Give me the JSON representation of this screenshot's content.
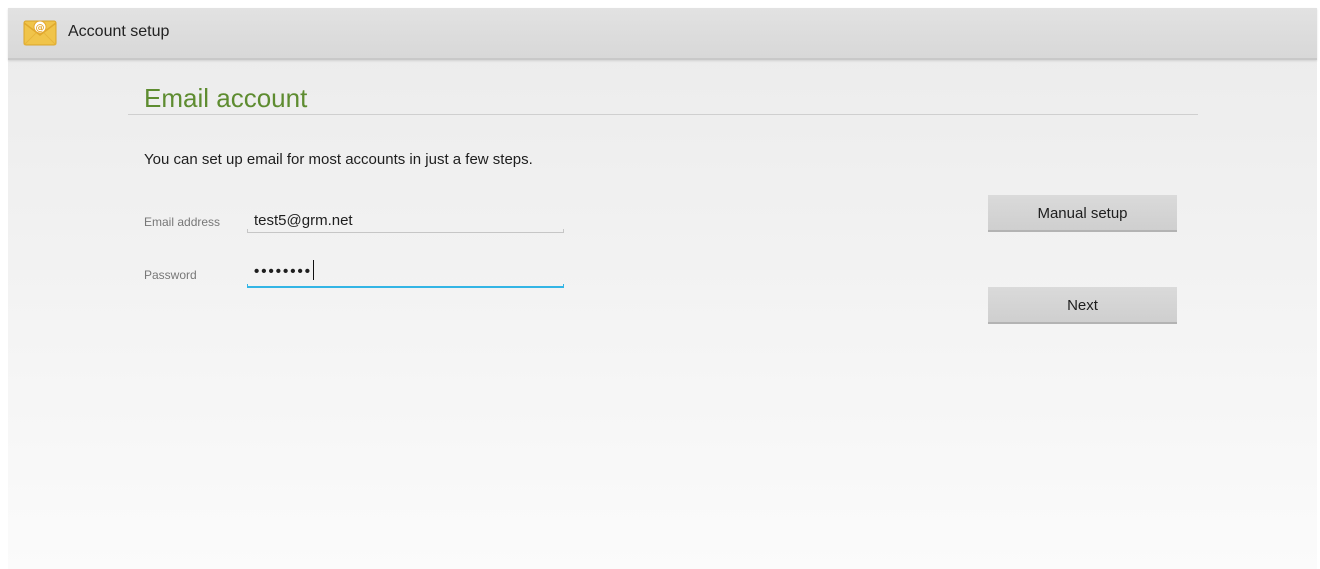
{
  "actionbar": {
    "title": "Account setup",
    "icon": "email-app-icon"
  },
  "main": {
    "heading": "Email account",
    "instructions": "You can set up email for most accounts in just a few steps."
  },
  "form": {
    "email": {
      "label": "Email address",
      "value": "test5@grm.net"
    },
    "password": {
      "label": "Password",
      "masked_value": "••••••••"
    }
  },
  "buttons": {
    "manual_setup": "Manual setup",
    "next": "Next"
  },
  "colors": {
    "heading": "#5e8c30",
    "focus_underline": "#33b5e5",
    "button": "#d4d4d4"
  }
}
